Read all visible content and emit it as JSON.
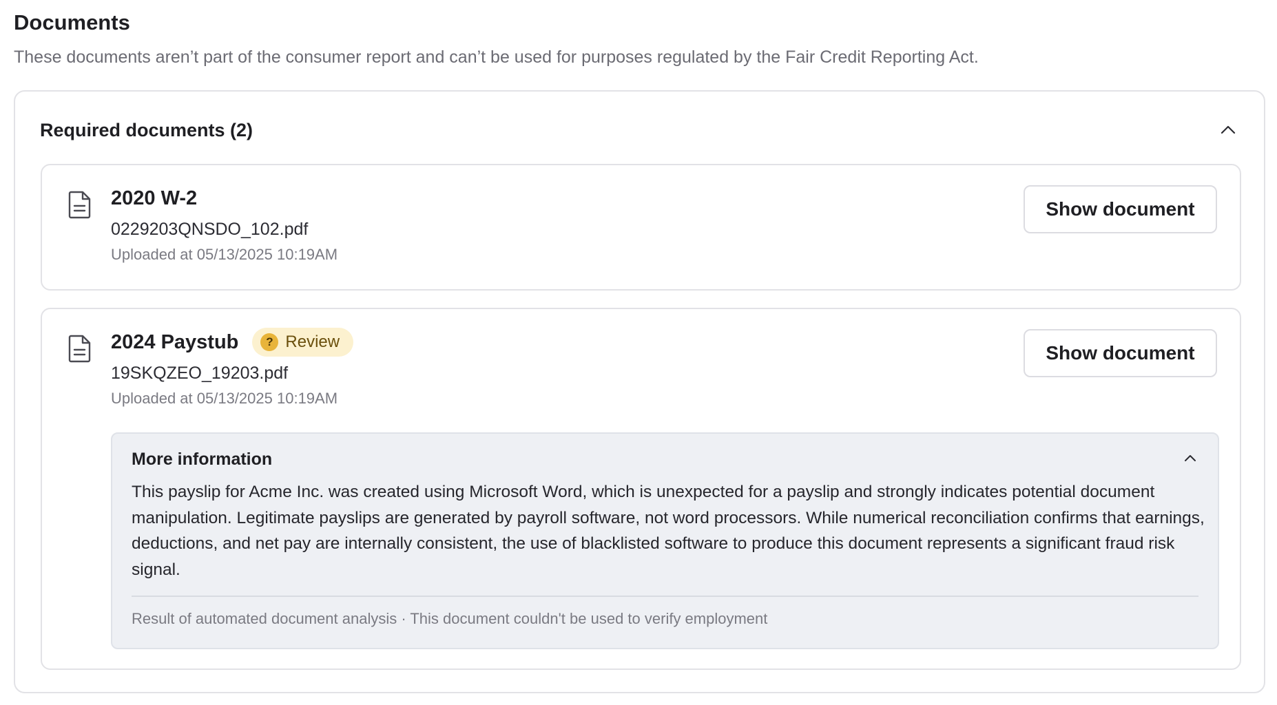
{
  "page": {
    "title": "Documents",
    "subtitle": "These documents aren’t part of the consumer report and can’t be used for purposes regulated by the Fair Credit Reporting Act."
  },
  "section": {
    "title": "Required documents (2)",
    "collapse_icon": "chevron-up-icon"
  },
  "documents": [
    {
      "icon": "file-text-icon",
      "title": "2020 W-2",
      "filename": "0229203QNSDO_102.pdf",
      "uploaded": "Uploaded at 05/13/2025 10:19AM",
      "button_label": "Show document"
    },
    {
      "icon": "file-text-icon",
      "title": "2024 Paystub",
      "badge": {
        "icon": "?",
        "label": "Review",
        "bg_color": "#fcf1cf",
        "icon_color": "#e8b43a"
      },
      "filename": "19SKQZEO_19203.pdf",
      "uploaded": "Uploaded at 05/13/2025 10:19AM",
      "button_label": "Show document",
      "more_info": {
        "title": "More information",
        "toggle_icon": "chevron-up-icon",
        "body": "This payslip for Acme Inc. was created using Microsoft Word, which is unexpected for a payslip and strongly indicates potential document manipulation. Legitimate payslips are generated by payroll software, not word processors. While numerical reconciliation confirms that earnings, deductions, and net pay are internally consistent, the use of blacklisted software to produce this document represents a significant fraud risk signal.",
        "footer": "Result of automated document analysis · This document couldn't be used to verify employment"
      }
    }
  ]
}
